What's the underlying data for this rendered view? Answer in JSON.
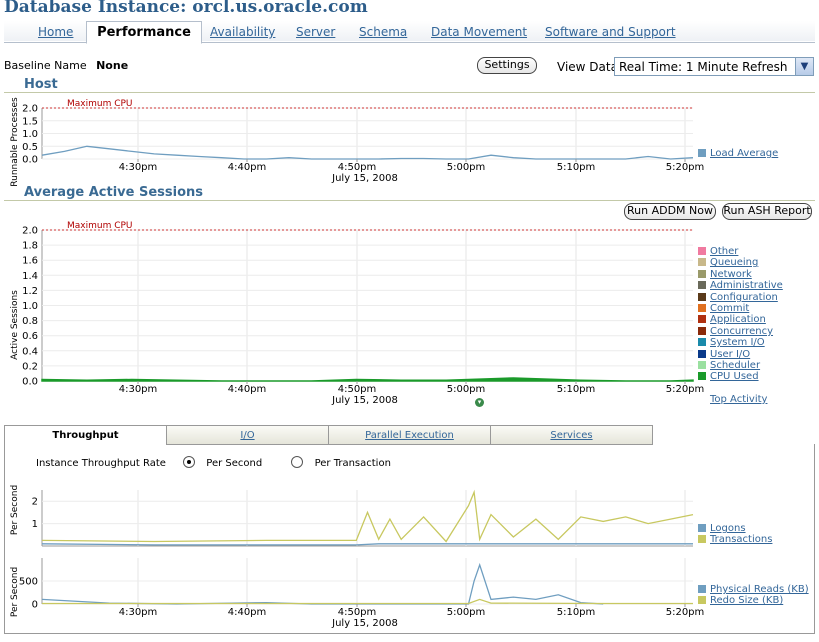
{
  "page": {
    "title": "Database Instance: orcl.us.oracle.com"
  },
  "tabs": [
    {
      "label": "Home",
      "active": false
    },
    {
      "label": "Performance",
      "active": true
    },
    {
      "label": "Availability",
      "active": false
    },
    {
      "label": "Server",
      "active": false
    },
    {
      "label": "Schema",
      "active": false
    },
    {
      "label": "Data Movement",
      "active": false
    },
    {
      "label": "Software and Support",
      "active": false
    }
  ],
  "baseline": {
    "label": "Baseline Name",
    "value": "None"
  },
  "settings_button": "Settings",
  "view_data": {
    "label": "View Data",
    "selected": "Real Time: 1 Minute Refresh"
  },
  "host": {
    "title": "Host",
    "ylabel": "Runnable Processes",
    "threshold_label": "Maximum CPU",
    "legend": [
      {
        "label": "Load Average",
        "color": "#6f9ec0"
      }
    ]
  },
  "aas": {
    "title": "Average Active Sessions",
    "ylabel": "Active Sessions",
    "threshold_label": "Maximum CPU",
    "run_addm": "Run ADDM Now",
    "run_ash": "Run ASH Report",
    "legend": [
      {
        "label": "Other",
        "color": "#f07aa0"
      },
      {
        "label": "Queueing",
        "color": "#c8b88a"
      },
      {
        "label": "Network",
        "color": "#9a9a6a"
      },
      {
        "label": "Administrative",
        "color": "#6a6a5a"
      },
      {
        "label": "Configuration",
        "color": "#5a3a1a"
      },
      {
        "label": "Commit",
        "color": "#e07020"
      },
      {
        "label": "Application",
        "color": "#b03010"
      },
      {
        "label": "Concurrency",
        "color": "#8a2a0a"
      },
      {
        "label": "System I/O",
        "color": "#1a8aaa"
      },
      {
        "label": "User I/O",
        "color": "#0a3a8a"
      },
      {
        "label": "Scheduler",
        "color": "#9ae0a0"
      },
      {
        "label": "CPU Used",
        "color": "#1a9a2a"
      }
    ],
    "top_activity": "Top Activity"
  },
  "time_axis": {
    "ticks": [
      "4:30pm",
      "4:40pm",
      "4:50pm",
      "5:00pm",
      "5:10pm",
      "5:20pm"
    ],
    "date": "July 15, 2008"
  },
  "bottom_tabs": [
    {
      "label": "Throughput",
      "active": true
    },
    {
      "label": "I/O",
      "active": false
    },
    {
      "label": "Parallel Execution",
      "active": false
    },
    {
      "label": "Services",
      "active": false
    }
  ],
  "throughput": {
    "rate_label": "Instance Throughput Rate",
    "options": [
      {
        "label": "Per Second",
        "checked": true
      },
      {
        "label": "Per Transaction",
        "checked": false
      }
    ],
    "ylabel_top": "Per Second",
    "ylabel_bottom": "Per Second",
    "legend_top": [
      {
        "label": "Logons",
        "color": "#6f9ec0"
      },
      {
        "label": "Transactions",
        "color": "#c8c860"
      }
    ],
    "legend_bottom": [
      {
        "label": "Physical Reads (KB)",
        "color": "#6f9ec0"
      },
      {
        "label": "Redo Size (KB)",
        "color": "#c8c860"
      }
    ]
  },
  "chart_data": [
    {
      "type": "line",
      "title": "Host",
      "ylabel": "Runnable Processes",
      "ylim": [
        0,
        2.0
      ],
      "yticks": [
        0.0,
        0.5,
        1.0,
        1.5,
        2.0
      ],
      "threshold": {
        "label": "Maximum CPU",
        "value": 2.0
      },
      "series": [
        {
          "name": "Load Average",
          "color": "#6f9ec0",
          "x": [
            0,
            2,
            4,
            6,
            8,
            10,
            12,
            14,
            16,
            18,
            20,
            22,
            24,
            26,
            28,
            30,
            32,
            34,
            36,
            38,
            40,
            42,
            44,
            46,
            48,
            50,
            52,
            54,
            56,
            58
          ],
          "values": [
            0.15,
            0.3,
            0.5,
            0.4,
            0.3,
            0.2,
            0.15,
            0.1,
            0.05,
            0.0,
            0.0,
            0.05,
            0.0,
            0.0,
            0.0,
            0.0,
            0.02,
            0.02,
            0.0,
            0.0,
            0.15,
            0.05,
            0.0,
            0.0,
            0.0,
            0.0,
            0.0,
            0.1,
            0.0,
            0.05
          ]
        }
      ]
    },
    {
      "type": "area",
      "title": "Average Active Sessions",
      "ylabel": "Active Sessions",
      "ylim": [
        0,
        2.0
      ],
      "yticks": [
        0.0,
        0.2,
        0.4,
        0.6,
        0.8,
        1.0,
        1.2,
        1.4,
        1.6,
        1.8,
        2.0
      ],
      "threshold": {
        "label": "Maximum CPU",
        "value": 2.0
      },
      "series": [
        {
          "name": "CPU Used",
          "color": "#1a9a2a",
          "x": [
            0,
            4,
            8,
            12,
            16,
            20,
            24,
            28,
            32,
            36,
            40,
            42,
            44,
            46,
            48,
            52,
            56,
            58
          ],
          "values": [
            0.02,
            0.01,
            0.02,
            0.01,
            0.0,
            0.0,
            0.0,
            0.02,
            0.01,
            0.01,
            0.03,
            0.04,
            0.03,
            0.02,
            0.01,
            0.0,
            0.0,
            0.01
          ]
        }
      ]
    },
    {
      "type": "line",
      "title": "Throughput",
      "ylabel": "Per Second",
      "ylim": [
        0,
        2.5
      ],
      "yticks": [
        1,
        2
      ],
      "series": [
        {
          "name": "Logons",
          "color": "#6f9ec0",
          "x": [
            0,
            10,
            20,
            28,
            30,
            40,
            50,
            58
          ],
          "values": [
            0.1,
            0.05,
            0.05,
            0.05,
            0.1,
            0.1,
            0.1,
            0.1
          ]
        },
        {
          "name": "Transactions",
          "color": "#c8c860",
          "x": [
            0,
            10,
            20,
            28,
            29,
            30,
            31,
            32,
            34,
            36,
            38,
            38.5,
            39,
            40,
            42,
            44,
            46,
            48,
            50,
            52,
            54,
            56,
            58
          ],
          "values": [
            0.25,
            0.2,
            0.25,
            0.25,
            1.5,
            0.3,
            1.2,
            0.3,
            1.3,
            0.2,
            1.8,
            2.4,
            0.3,
            1.4,
            0.4,
            1.2,
            0.3,
            1.3,
            1.1,
            1.3,
            1.0,
            1.2,
            1.4
          ]
        }
      ]
    },
    {
      "type": "line",
      "title": "I/O",
      "ylabel": "Per Second",
      "ylim": [
        0,
        1000
      ],
      "yticks": [
        0,
        500
      ],
      "series": [
        {
          "name": "Physical Reads (KB)",
          "color": "#6f9ec0",
          "x": [
            0,
            6,
            12,
            20,
            24,
            38,
            38.5,
            39,
            40,
            42,
            44,
            46,
            48,
            50
          ],
          "values": [
            100,
            20,
            0,
            30,
            0,
            0,
            500,
            850,
            100,
            150,
            100,
            200,
            30,
            0
          ]
        },
        {
          "name": "Redo Size (KB)",
          "color": "#c8c860",
          "x": [
            0,
            10,
            20,
            30,
            38,
            39,
            40,
            50,
            58
          ],
          "values": [
            10,
            10,
            10,
            10,
            10,
            100,
            20,
            10,
            10
          ]
        }
      ]
    }
  ]
}
